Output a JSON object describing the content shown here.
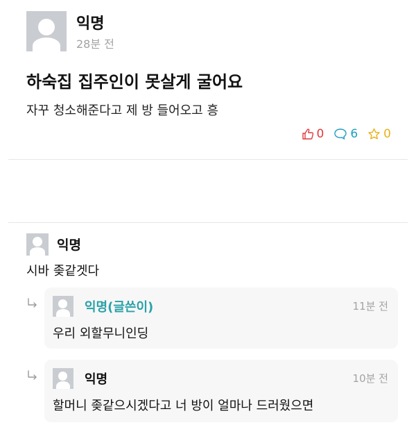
{
  "post": {
    "author": "익명",
    "time": "28분 전",
    "title": "하숙집 집주인이 못살게 굴어요",
    "body": "자꾸 청소해준다고 제 방 들어오고 흥",
    "likes": "0",
    "comments": "6",
    "scraps": "0"
  },
  "comments": [
    {
      "author": "익명",
      "text": "시바 좆같겟다",
      "replies": [
        {
          "author": "익명(글쓴이)",
          "time": "11분 전",
          "text": "우리 외할무니인딩"
        },
        {
          "author": "익명",
          "time": "10분 전",
          "text": "할머니 좆같으시겠다고 너 방이 얼마나 드러웠으면"
        }
      ]
    }
  ],
  "colors": {
    "like": "#e0393e",
    "comment": "#1f9ec0",
    "scrap": "#e8b21a",
    "writer_name": "#2aa1a8",
    "avatar_bg": "#c9ccd1",
    "reply_bg": "#f7f7f7"
  },
  "icons": [
    "thumbs-up-icon",
    "speech-bubble-icon",
    "star-icon",
    "reply-arrow-icon",
    "avatar-icon"
  ]
}
